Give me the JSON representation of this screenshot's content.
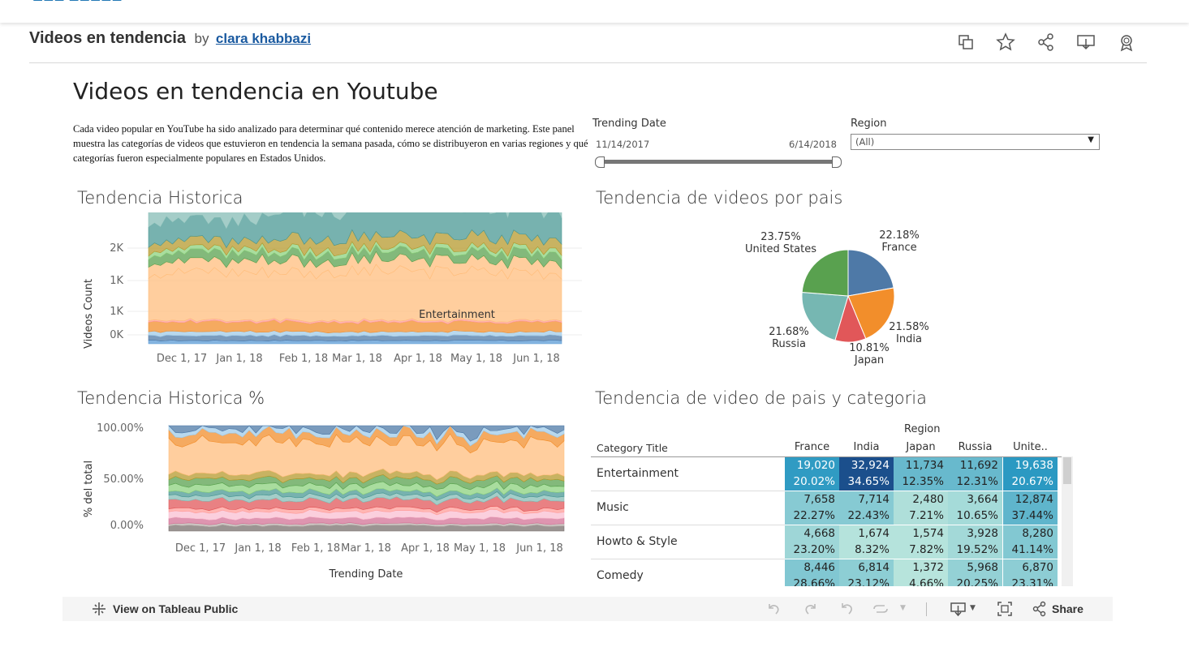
{
  "header": {
    "viz_title": "Videos en tendencia",
    "by": "by",
    "author": "clara khabbazi"
  },
  "toolbar_icons": [
    "copy-icon",
    "star-icon",
    "share-icon",
    "download-icon",
    "award-icon"
  ],
  "dashboard": {
    "title": "Videos en tendencia en Youtube",
    "description": "Cada video popular en YouTube ha sido analizado para determinar qué contenido merece atención de marketing. Este panel muestra las categorías de videos que estuvieron en tendencia la semana pasada, cómo se distribuyeron en varias regiones y qué categorías fueron especialmente populares en Estados Unidos."
  },
  "filters": {
    "trending_date": {
      "label": "Trending Date",
      "start": "11/14/2017",
      "end": "6/14/2018"
    },
    "region": {
      "label": "Region",
      "value": "(All)"
    }
  },
  "sections": {
    "historica": "Tendencia Historica",
    "historica_pct": "Tendencia Historica %",
    "por_pais": "Tendencia de videos por pais",
    "pais_categoria": "Tendencia de video de pais y categoria"
  },
  "chart_data": [
    {
      "type": "area",
      "title": "Tendencia Historica",
      "ylabel": "Videos Count",
      "xlabel": "",
      "y_ticks": [
        "2K",
        "1K",
        "1K",
        "0K"
      ],
      "x_ticks": [
        "Dec 1, 17",
        "Jan 1, 18",
        "Feb 1, 18",
        "Mar 1, 18",
        "Apr 1, 18",
        "May 1, 18",
        "Jun 1, 18"
      ],
      "annotation": "Entertainment",
      "colors": [
        "#5b9bd5",
        "#4e79a7",
        "#f28e2b",
        "#ffbe7d",
        "#59a14f",
        "#8cd17d",
        "#499894",
        "#86bcb6",
        "#e15759",
        "#ff9d9a",
        "#79706e",
        "#bab0ac",
        "#d37295",
        "#fabfd2"
      ]
    },
    {
      "type": "area",
      "title": "Tendencia Historica %",
      "ylabel": "% del total",
      "xlabel": "Trending Date",
      "y_ticks": [
        "100.00%",
        "50.00%",
        "0.00%"
      ],
      "x_ticks": [
        "Dec 1, 17",
        "Jan 1, 18",
        "Feb 1, 18",
        "Mar 1, 18",
        "Apr 1, 18",
        "May 1, 18",
        "Jun 1, 18"
      ]
    },
    {
      "type": "pie",
      "title": "Tendencia de videos por pais",
      "slices": [
        {
          "name": "France",
          "value": 22.18,
          "label": "22.18%",
          "color": "#4e79a7"
        },
        {
          "name": "India",
          "value": 21.58,
          "label": "21.58%",
          "color": "#f28e2b"
        },
        {
          "name": "Japan",
          "value": 10.81,
          "label": "10.81%",
          "color": "#e15759"
        },
        {
          "name": "Russia",
          "value": 21.68,
          "label": "21.68%",
          "color": "#76b7b2"
        },
        {
          "name": "United States",
          "value": 23.75,
          "label": "23.75%",
          "color": "#59a14f"
        }
      ]
    },
    {
      "type": "heatmap",
      "title": "Tendencia de video de pais y categoria",
      "column_header": "Region",
      "row_header": "Category Title",
      "columns": [
        "France",
        "India",
        "Japan",
        "Russia",
        "Unite.."
      ],
      "rows": [
        {
          "name": "Entertainment",
          "counts": [
            "19,020",
            "32,924",
            "11,734",
            "11,692",
            "19,638"
          ],
          "pcts": [
            "20.02%",
            "34.65%",
            "12.35%",
            "12.31%",
            "20.67%"
          ],
          "count_values": [
            19020,
            32924,
            11734,
            11692,
            19638
          ]
        },
        {
          "name": "Music",
          "counts": [
            "7,658",
            "7,714",
            "2,480",
            "3,664",
            "12,874"
          ],
          "pcts": [
            "22.27%",
            "22.43%",
            "7.21%",
            "10.65%",
            "37.44%"
          ],
          "count_values": [
            7658,
            7714,
            2480,
            3664,
            12874
          ]
        },
        {
          "name": "Howto & Style",
          "counts": [
            "4,668",
            "1,674",
            "1,574",
            "3,928",
            "8,280"
          ],
          "pcts": [
            "23.20%",
            "8.32%",
            "7.82%",
            "19.52%",
            "41.14%"
          ],
          "count_values": [
            4668,
            1674,
            1574,
            3928,
            8280
          ]
        },
        {
          "name": "Comedy",
          "counts": [
            "8,446",
            "6,814",
            "1,372",
            "5,968",
            "6,870"
          ],
          "pcts": [
            "28.66%",
            "23.12%",
            "4.66%",
            "20.25%",
            "23.31%"
          ],
          "count_values": [
            8446,
            6814,
            1372,
            5968,
            6870
          ]
        }
      ]
    }
  ],
  "footer": {
    "view_link": "View on Tableau Public",
    "share": "Share"
  }
}
